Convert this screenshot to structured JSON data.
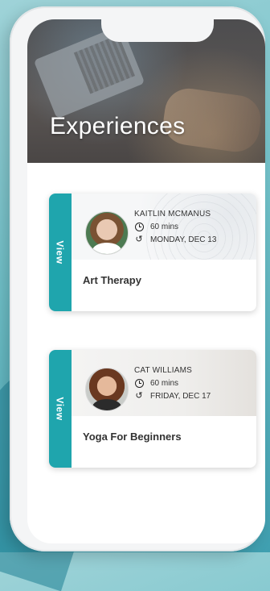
{
  "header": {
    "title": "Experiences"
  },
  "cards": [
    {
      "view_label": "View",
      "host": "KAITLIN MCMANUS",
      "duration": "60 mins",
      "date": "MONDAY, DEC 13",
      "title": "Art Therapy"
    },
    {
      "view_label": "View",
      "host": "CAT WILLIAMS",
      "duration": "60 mins",
      "date": "FRIDAY, DEC 17",
      "title": "Yoga For Beginners"
    }
  ],
  "icons": {
    "duration": "clock-icon",
    "date": "history-icon"
  },
  "colors": {
    "accent": "#1fa5ad",
    "hero_text": "#ffffff",
    "card_text": "#333333"
  }
}
